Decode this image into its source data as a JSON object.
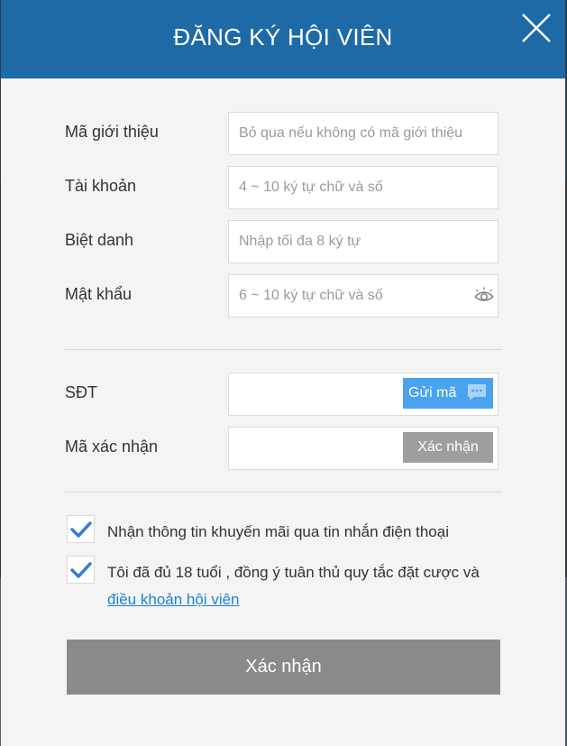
{
  "modal": {
    "title": "ĐĂNG KÝ HỘI VIÊN",
    "header_color": "#1e6aa6"
  },
  "form": {
    "referral": {
      "label": "Mã giới thiệu",
      "placeholder": "Bỏ qua nếu không có mã giới thiệu",
      "value": ""
    },
    "account": {
      "label": "Tài khoản",
      "placeholder": "4 ~ 10 ký tự chữ và số",
      "value": ""
    },
    "nickname": {
      "label": "Biệt danh",
      "placeholder": "Nhập tối đa 8 ký tự",
      "value": ""
    },
    "password": {
      "label": "Mật khẩu",
      "placeholder": "6 ~ 10 ký tự chữ và số",
      "value": ""
    },
    "phone": {
      "label": "SĐT",
      "placeholder": "",
      "value": "",
      "send_code_label": "Gửi mã"
    },
    "verification": {
      "label": "Mã xác nhận",
      "placeholder": "",
      "value": "",
      "verify_label": "Xác nhận"
    }
  },
  "agreements": {
    "promo": {
      "text": "Nhận thông tin khuyến mãi qua tin nhắn điện thoại",
      "checked": true
    },
    "terms": {
      "text": "Tôi đã đủ 18 tuổi , đồng ý tuân thủ quy tắc đặt cược và",
      "link_text": "điều khoản hội viên",
      "checked": true
    }
  },
  "submit": {
    "label": "Xác nhận"
  },
  "icons": {
    "close": "close-icon",
    "eye": "eye-icon",
    "chat": "chat-bubble-icon",
    "check": "checkmark-icon"
  },
  "colors": {
    "accent": "#4aa3ee",
    "link": "#1a82d6",
    "check": "#3b7ad9",
    "disabled_button": "#8a8a8a"
  }
}
